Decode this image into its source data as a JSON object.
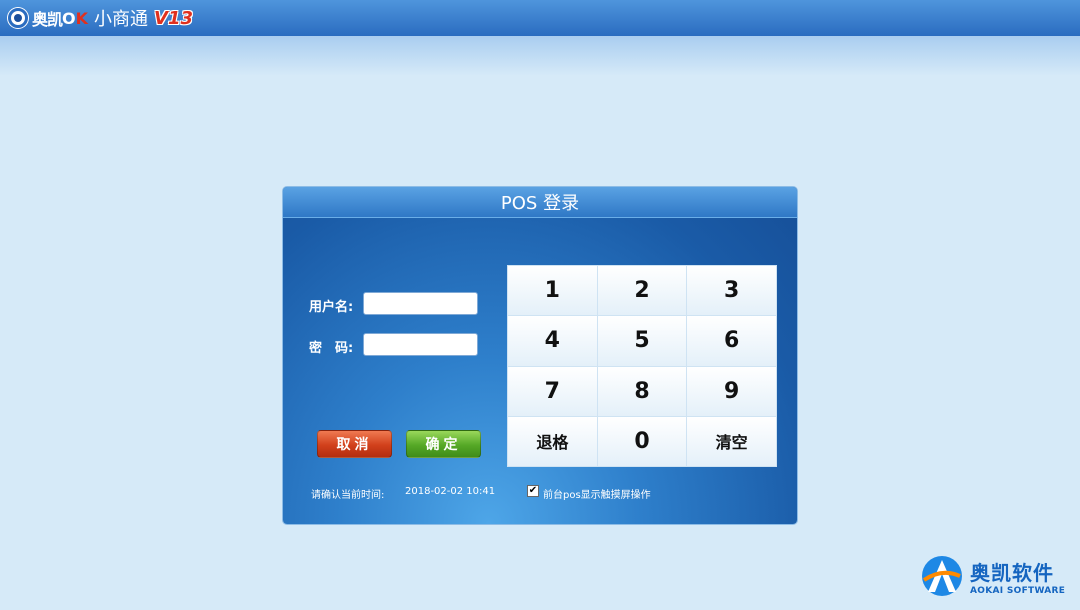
{
  "header": {
    "brand_name": "奥凯",
    "brand_ok_o": "O",
    "brand_ok_k": "K",
    "app_name": "小商通",
    "app_version": "V13"
  },
  "login": {
    "title": "POS 登录",
    "username_label": "用户名:",
    "username_value": "",
    "password_label": "密　码:",
    "password_value": "",
    "cancel_label": "取消",
    "confirm_label": "确定",
    "time_label": "请确认当前时间:",
    "time_value": "2018-02-02  10:41",
    "touch_checked": true,
    "touch_check_glyph": "✔",
    "touch_label": "前台pos显示触摸屏操作"
  },
  "keypad": {
    "keys": [
      "1",
      "2",
      "3",
      "4",
      "5",
      "6",
      "7",
      "8",
      "9",
      "退格",
      "0",
      "清空"
    ]
  },
  "company": {
    "name": "奥凯软件",
    "name_en": "AOKAI SOFTWARE"
  },
  "colors": {
    "topbar": "#2a6cc0",
    "panel": "#1a5ba7",
    "cancel_button": "#d1401b",
    "confirm_button": "#55a826",
    "brand_red": "#e0301e"
  }
}
